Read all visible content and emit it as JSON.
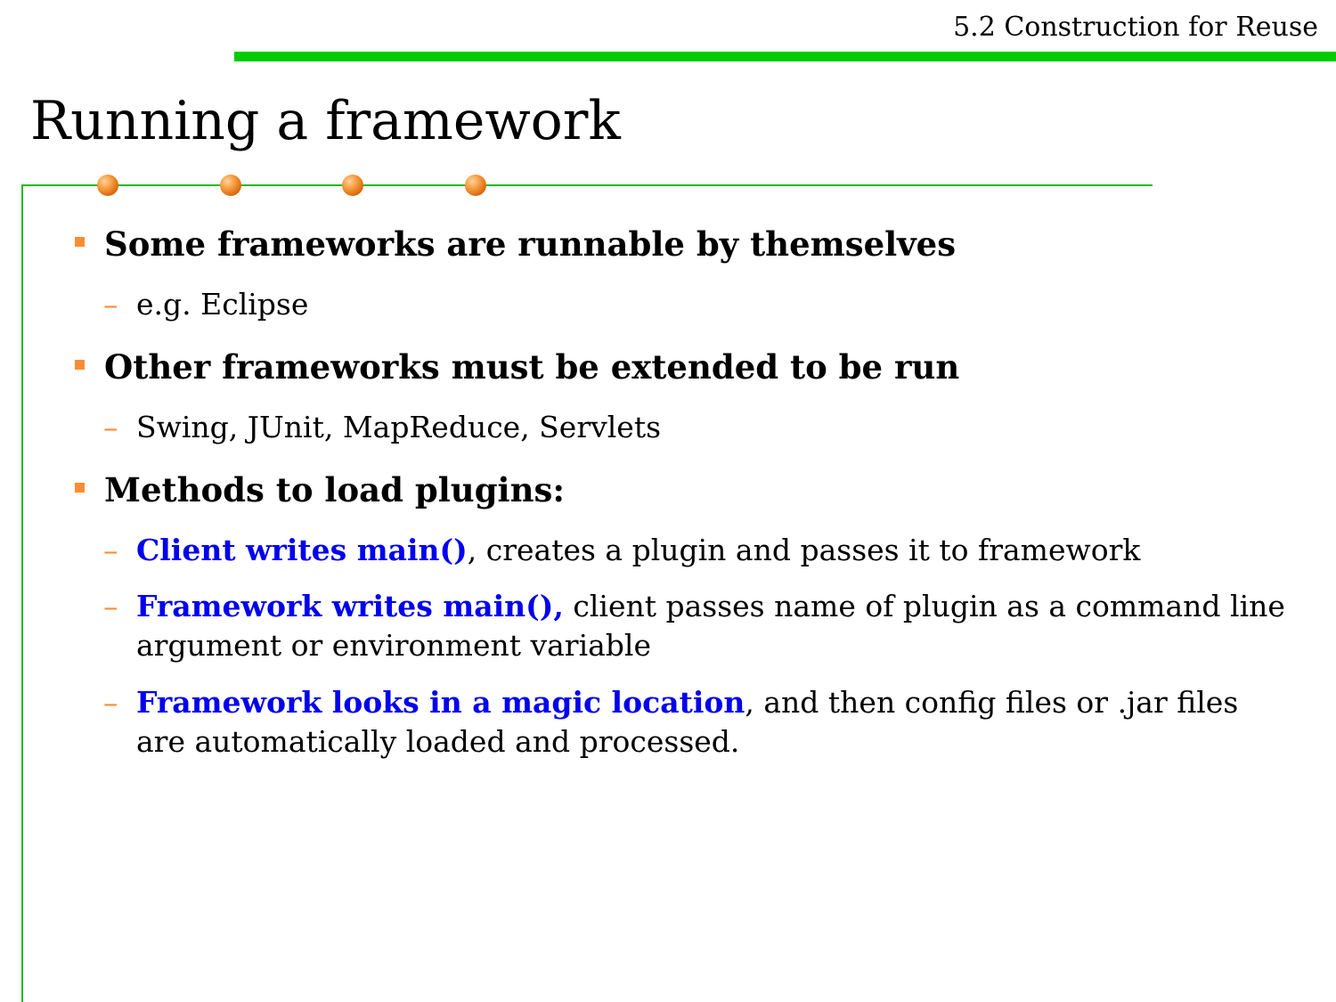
{
  "header": {
    "section": "5.2 Construction for Reuse"
  },
  "title": "Running a framework",
  "colors": {
    "top_bar": "#00cc00",
    "rule": "#22bb22",
    "accent": "#ff8c33",
    "highlight": "#0000ee"
  },
  "bullets": [
    {
      "text": "Some frameworks are runnable by themselves",
      "subitems": [
        {
          "text": "e.g. Eclipse"
        }
      ]
    },
    {
      "text": "Other frameworks must be extended to be run",
      "subitems": [
        {
          "text": "Swing, JUnit, MapReduce, Servlets"
        }
      ]
    },
    {
      "text": "Methods to load plugins:",
      "subitems": [
        {
          "highlight": "Client writes main()",
          "rest": ", creates a plugin and passes it to framework"
        },
        {
          "highlight": "Framework writes main(),",
          "rest": " client passes name of plugin as a command line argument or environment variable"
        },
        {
          "highlight": "Framework looks in a magic location",
          "rest": ", and then config files or .jar files are automatically loaded and processed."
        }
      ]
    }
  ]
}
